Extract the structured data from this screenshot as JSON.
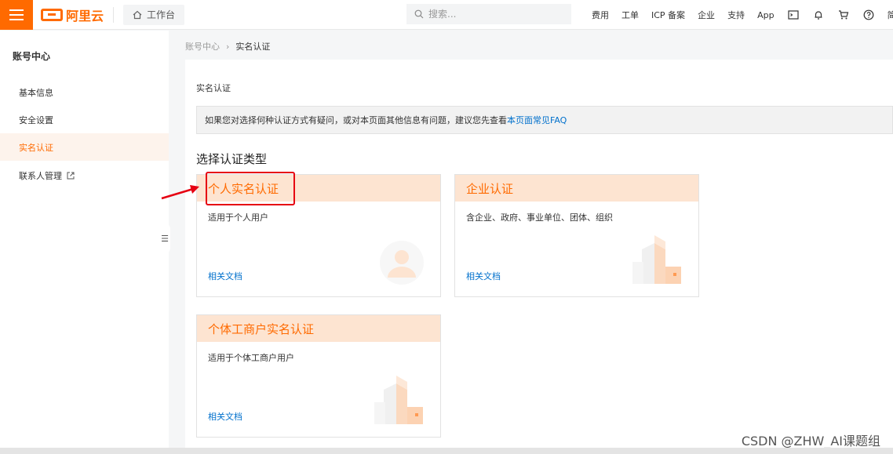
{
  "topbar": {
    "brand": "阿里云",
    "workbench_label": "工作台",
    "search_placeholder": "搜索...",
    "nav_links": [
      "费用",
      "工单",
      "ICP 备案",
      "企业",
      "支持",
      "App"
    ],
    "language": "简体"
  },
  "sidebar": {
    "title": "账号中心",
    "items": [
      {
        "label": "基本信息"
      },
      {
        "label": "安全设置"
      },
      {
        "label": "实名认证"
      },
      {
        "label": "联系人管理"
      }
    ]
  },
  "breadcrumb": {
    "root": "账号中心",
    "separator": "›",
    "current": "实名认证"
  },
  "main": {
    "title": "实名认证",
    "notice_text": "如果您对选择何种认证方式有疑问，或对本页面其他信息有问题，建议您先查看",
    "notice_link": "本页面常见FAQ",
    "section_title": "选择认证类型",
    "cards": [
      {
        "title": "个人实名认证",
        "desc": "适用于个人用户",
        "link": "相关文档"
      },
      {
        "title": "企业认证",
        "desc": "含企业、政府、事业单位、团体、组织",
        "link": "相关文档"
      },
      {
        "title": "个体工商户实名认证",
        "desc": "适用于个体工商户用户",
        "link": "相关文档"
      }
    ]
  },
  "watermark": "CSDN @ZHW_AI课题组",
  "colors": {
    "brand": "#ff6a00",
    "card_head_bg": "#fde4d1",
    "link": "#0070cc",
    "highlight": "#e60012"
  }
}
